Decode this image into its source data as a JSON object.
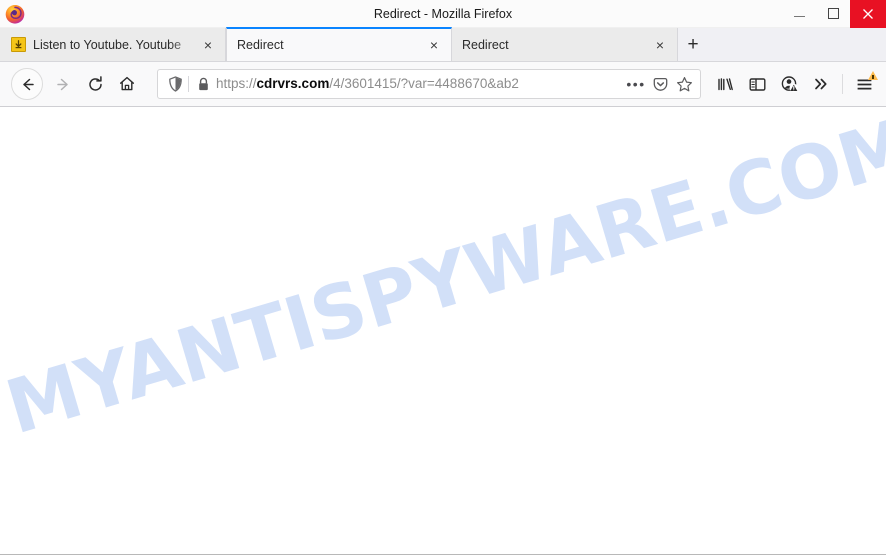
{
  "window": {
    "title": "Redirect - Mozilla Firefox",
    "app_icon": "firefox-logo",
    "controls": {
      "minimize": "minimize-icon",
      "maximize": "maximize-icon",
      "close": "close-icon",
      "close_color": "#e81123"
    }
  },
  "tabs": {
    "items": [
      {
        "label": "Listen to Youtube. Youtube",
        "favicon": "download-arrow-icon",
        "active": false,
        "close": "×"
      },
      {
        "label": "Redirect",
        "favicon": "none",
        "active": true,
        "close": "×"
      },
      {
        "label": "Redirect",
        "favicon": "none",
        "active": false,
        "close": "×"
      }
    ],
    "new_tab_label": "+",
    "active_accent_color": "#0a84ff"
  },
  "navigation": {
    "back": "back-arrow-icon",
    "forward": "forward-arrow-icon",
    "reload": "reload-icon",
    "home": "home-icon"
  },
  "urlbar": {
    "shield_icon": "tracking-protection-shield-icon",
    "lock_icon": "padlock-icon",
    "scheme": "https://",
    "host": "cdrvrs.com",
    "path": "/4/3601415/?var=4488670&ab2",
    "full_url": "https://cdrvrs.com/4/3601415/?var=4488670&ab2",
    "page_actions": "•••",
    "pocket_icon": "pocket-icon",
    "bookmark_icon": "star-icon"
  },
  "toolbar_right": {
    "library": "library-icon",
    "sidebar": "sidebar-icon",
    "account": "account-warning-icon",
    "overflow": "»",
    "menu": "hamburger-menu-icon",
    "menu_badge": "warning-triangle-icon",
    "badge_color": "#ffbd4f"
  },
  "content": {
    "watermark_text": "MYANTISPYWARE.COM",
    "watermark_color": "#cfdef8",
    "background": "#ffffff"
  }
}
